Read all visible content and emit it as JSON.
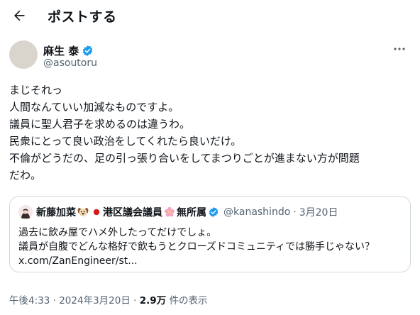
{
  "header": {
    "title": "ポストする"
  },
  "author": {
    "display_name": "麻生 泰",
    "handle": "@asoutoru"
  },
  "tweet": {
    "lines": [
      "まじそれっ",
      "人間なんていい加減なものですよ。",
      "議員に聖人君子を求めるのは違うわ。",
      "民衆にとって良い政治をしてくれたら良いだけ。",
      "不倫がどうだの、足の引っ張り合いをしてまつりごとが進まない方が問題",
      "だわ。"
    ]
  },
  "quote": {
    "name_part1": "新藤加菜",
    "name_part2": "港区議会議員",
    "name_part3": "無所属",
    "handle": "@kanashindo",
    "separator": "·",
    "date": "3月20日",
    "lines": [
      "過去に飲み屋でハメ外したってだけでしょ。",
      "議員が自腹でどんな格好で飲もうとクローズドコミュニティでは勝手じゃない？"
    ],
    "link": "x.com/ZanEngineer/st..."
  },
  "meta": {
    "time": "午後4:33",
    "separator": "·",
    "date": "2024年3月20日",
    "views_count": "2.9万",
    "views_label": "件の表示"
  },
  "colors": {
    "verified": "#1d9bf0",
    "secondary_text": "#536471",
    "border": "#cfd9de"
  }
}
